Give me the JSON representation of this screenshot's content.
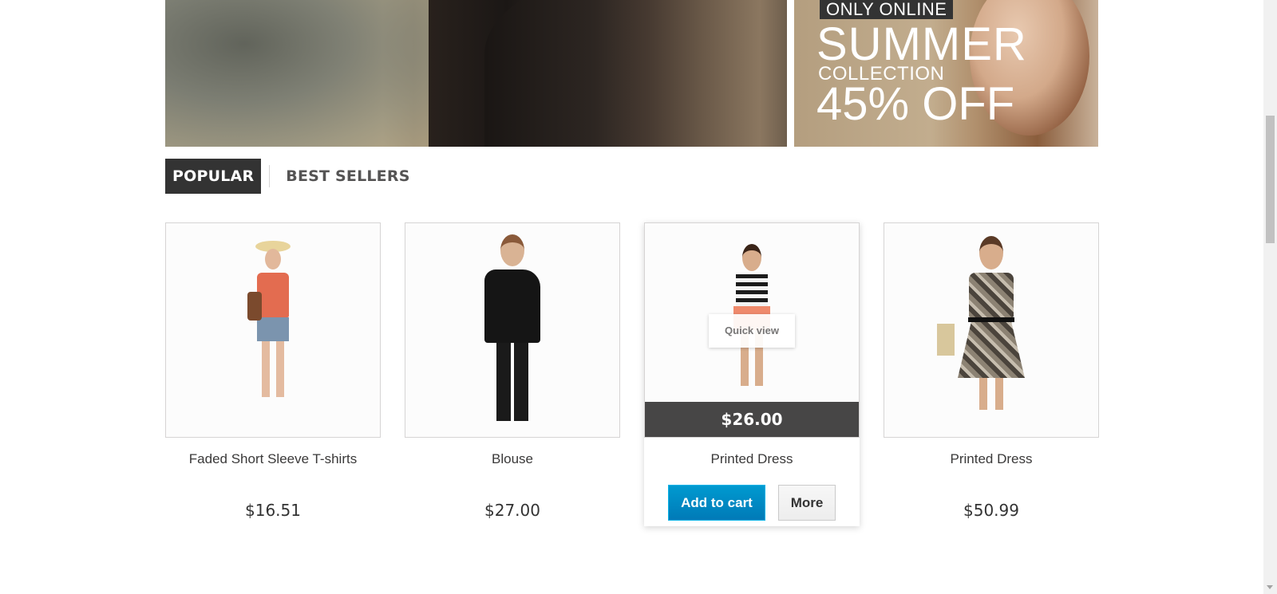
{
  "slider": {
    "prev_icon": "‹",
    "next_icon": "›"
  },
  "promo": {
    "tag": "ONLY ONLINE",
    "headline": "SUMMER",
    "subline": "COLLECTION",
    "discount": "45% OFF"
  },
  "tabs": [
    {
      "label": "POPULAR",
      "active": true
    },
    {
      "label": "BEST SELLERS",
      "active": false
    }
  ],
  "products": [
    {
      "name": "Faded Short Sleeve T-shirts",
      "price": "$16.51"
    },
    {
      "name": "Blouse",
      "price": "$27.00"
    },
    {
      "name": "Printed Dress",
      "price": "$26.00",
      "quick_view": "Quick view",
      "add_to_cart": "Add to cart",
      "more": "More"
    },
    {
      "name": "Printed Dress",
      "price": "$50.99"
    }
  ],
  "colors": {
    "tab_active_bg": "#333333",
    "cart_button": "#0089c6",
    "price_band": "#474646"
  }
}
